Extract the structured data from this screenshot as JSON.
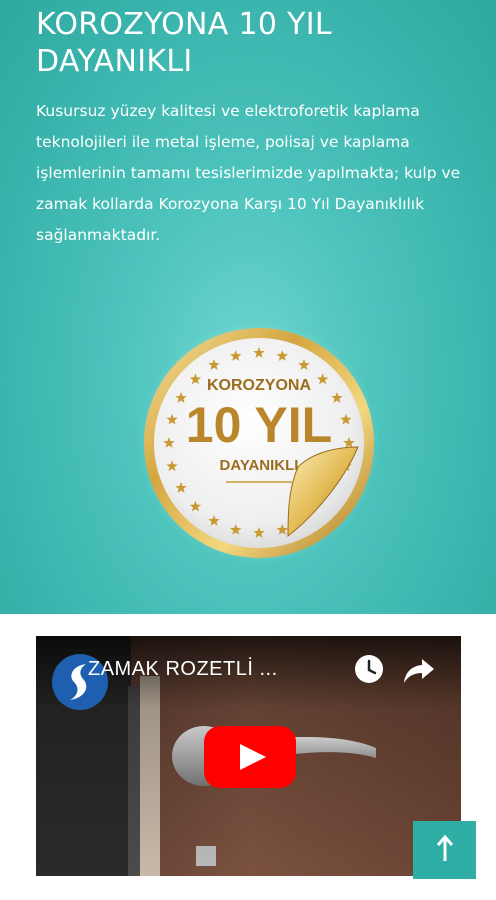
{
  "hero": {
    "title_line1": "KOROZYONA 10 YIL",
    "title_line2": "DAYANIKLI",
    "text": "Kusursuz yüzey kalitesi ve elektroforetik kaplama teknolojileri ile metal işleme, polisaj ve kaplama işlemlerinin tamamı tesislerimizde yapılmakta; kulp ve zamak kollarda Korozyona Karşı 10 Yıl Dayanıklılık sağlanmaktadır.",
    "background_color": "#3bb8b0"
  },
  "badge": {
    "line1": "KOROZYONA",
    "line2": "10 YIL",
    "line3": "DAYANIKLI",
    "icon": "gold-seal-icon"
  },
  "video": {
    "title": "ZAMAK ROZETLİ ...",
    "channel_icon": "channel-logo-icon",
    "watch_later_icon": "clock-icon",
    "share_icon": "share-icon",
    "play_icon": "youtube-play-icon",
    "play_color": "#ff0000"
  },
  "scroll_top": {
    "icon": "arrow-up-icon",
    "color": "#2eaea4"
  }
}
